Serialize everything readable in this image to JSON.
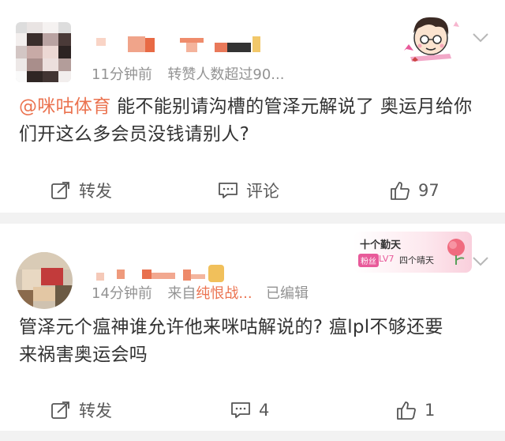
{
  "posts": [
    {
      "meta": {
        "time": "11分钟前",
        "extra": "转赞人数超过90..."
      },
      "body": {
        "mention": "@咪咕体育",
        "text": " 能不能别请沟槽的管泽元解说了 奥运月给你们开这么多会员没钱请别人?"
      },
      "actions": {
        "repost_label": "转发",
        "comment_label": "评论",
        "like_count": "97"
      },
      "icons": [
        "repost-icon",
        "comment-icon",
        "like-icon",
        "chevron-down-icon"
      ]
    },
    {
      "meta": {
        "time": "14分钟前",
        "source_prefix": "来自",
        "source": "纯恨战...",
        "edited": "已编辑"
      },
      "badge": {
        "title": "十个勤天",
        "tag": "粉丝",
        "level": "LV7",
        "subtitle": "四个晴天"
      },
      "body": {
        "text": "管泽元个瘟神谁允许他来咪咕解说的? 瘟lpl不够还要来祸害奥运会吗"
      },
      "actions": {
        "repost_label": "转发",
        "comment_count": "4",
        "like_count": "1"
      },
      "icons": [
        "repost-icon",
        "comment-icon",
        "like-icon",
        "chevron-down-icon"
      ]
    }
  ],
  "colors": {
    "link": "#eb7350",
    "meta": "#939393",
    "text": "#333333",
    "separator": "#f2f2f2"
  }
}
